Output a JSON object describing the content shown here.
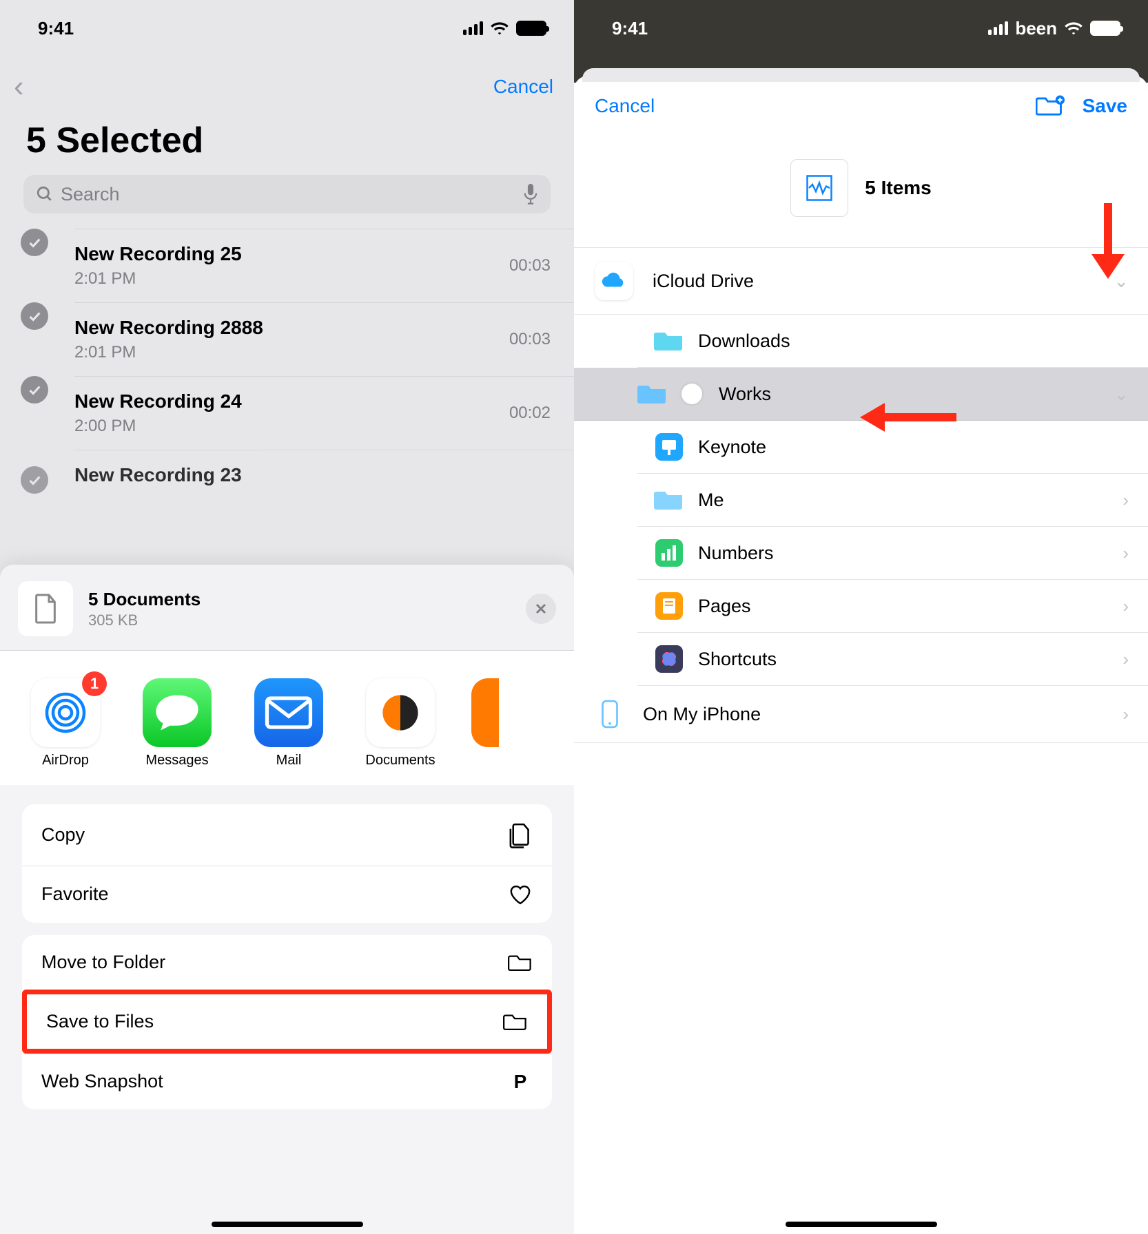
{
  "left": {
    "status_time": "9:41",
    "nav_cancel": "Cancel",
    "title": "5 Selected",
    "search_placeholder": "Search",
    "recordings": [
      {
        "title": "New Recording 25",
        "time": "2:01 PM",
        "duration": "00:03"
      },
      {
        "title": "New Recording 2888",
        "time": "2:01 PM",
        "duration": "00:03"
      },
      {
        "title": "New Recording 24",
        "time": "2:00 PM",
        "duration": "00:02"
      },
      {
        "title": "New Recording 23",
        "time": "",
        "duration": ""
      }
    ],
    "sheet": {
      "title": "5 Documents",
      "subtitle": "305 KB",
      "apps": [
        {
          "label": "AirDrop",
          "badge": "1"
        },
        {
          "label": "Messages",
          "badge": ""
        },
        {
          "label": "Mail",
          "badge": ""
        },
        {
          "label": "Documents",
          "badge": ""
        }
      ],
      "group1": [
        {
          "label": "Copy",
          "icon": "copy-icon"
        },
        {
          "label": "Favorite",
          "icon": "heart-icon"
        }
      ],
      "group2": [
        {
          "label": "Move to Folder",
          "icon": "folder-icon",
          "hl": false
        },
        {
          "label": "Save to Files",
          "icon": "folder-save-icon",
          "hl": true
        },
        {
          "label": "Web Snapshot",
          "icon": "p-icon",
          "hl": false
        }
      ]
    }
  },
  "right": {
    "status_time": "9:41",
    "cancel": "Cancel",
    "save": "Save",
    "items_label": "5 Items",
    "locations": {
      "root": "iCloud Drive",
      "sub": [
        {
          "label": "Downloads",
          "chevron": false,
          "icon": "folder-teal"
        },
        {
          "label": "Works",
          "chevron": true,
          "icon": "folder-blue",
          "selected": true
        },
        {
          "label": "Keynote",
          "chevron": false,
          "icon": "app-keynote"
        },
        {
          "label": "Me",
          "chevron": true,
          "icon": "folder-blue"
        },
        {
          "label": "Numbers",
          "chevron": true,
          "icon": "app-numbers"
        },
        {
          "label": "Pages",
          "chevron": true,
          "icon": "app-pages"
        },
        {
          "label": "Shortcuts",
          "chevron": true,
          "icon": "app-shortcuts"
        }
      ],
      "device": "On My iPhone"
    }
  }
}
